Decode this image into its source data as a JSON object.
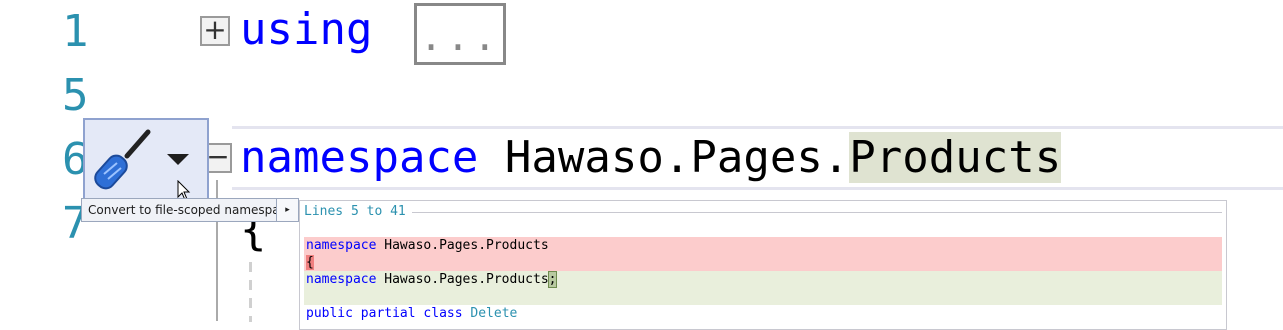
{
  "editor": {
    "line_numbers": [
      "1",
      "5",
      "6",
      "7"
    ],
    "line1": {
      "keyword": "using",
      "collapsed_text": "..."
    },
    "line6": {
      "keyword": "namespace",
      "name_prefix": "Hawaso.Pages.",
      "name_highlight": "Products"
    },
    "line7": {
      "text": "{"
    },
    "expand_glyph": "+",
    "collapse_glyph": "−"
  },
  "quick_actions": {
    "icon": "screwdriver-icon",
    "dropdown_icon": "caret-down-icon",
    "menu_item_label": "Convert to file-scoped namespace",
    "submenu_arrow": "▸"
  },
  "preview": {
    "title": "Lines 5 to 41",
    "removed_line1": {
      "kw": "namespace",
      "text": " Hawaso.Pages.Products"
    },
    "removed_line2": "{",
    "added_line": {
      "kw": "namespace",
      "text": " Hawaso.Pages.Products",
      "semicolon": ";"
    },
    "context_line": {
      "kw1": "public",
      "kw2": "partial",
      "kw3": "class",
      "type": "Delete"
    }
  },
  "colors": {
    "keyword": "#0000ff",
    "line_number": "#2b91af",
    "diff_removed": "#fccccc",
    "diff_added": "#e9efdc"
  }
}
